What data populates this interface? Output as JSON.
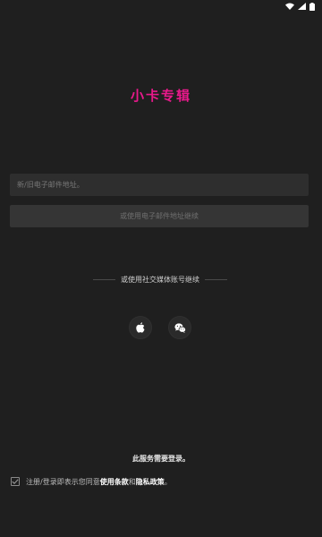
{
  "status_bar": {
    "icons": [
      "wifi-icon",
      "signal-icon",
      "battery-icon"
    ]
  },
  "app": {
    "title": "小卡专辑",
    "title_color": "#e8198b"
  },
  "login": {
    "email_placeholder": "新/旧电子邮件地址。",
    "email_value": "",
    "continue_label": "或使用电子邮件地址继续",
    "social_divider": "或使用社交媒体账号继续",
    "social_buttons": [
      {
        "icon": "apple-icon"
      },
      {
        "icon": "wechat-icon"
      }
    ]
  },
  "footer": {
    "service_note": "此服务需要登录。",
    "agree_checked": true,
    "agree_prefix": "注册/登录即表示您同意",
    "terms_label": "使用条款",
    "agree_and": "和",
    "privacy_label": "隐私政策",
    "agree_suffix": "。"
  }
}
